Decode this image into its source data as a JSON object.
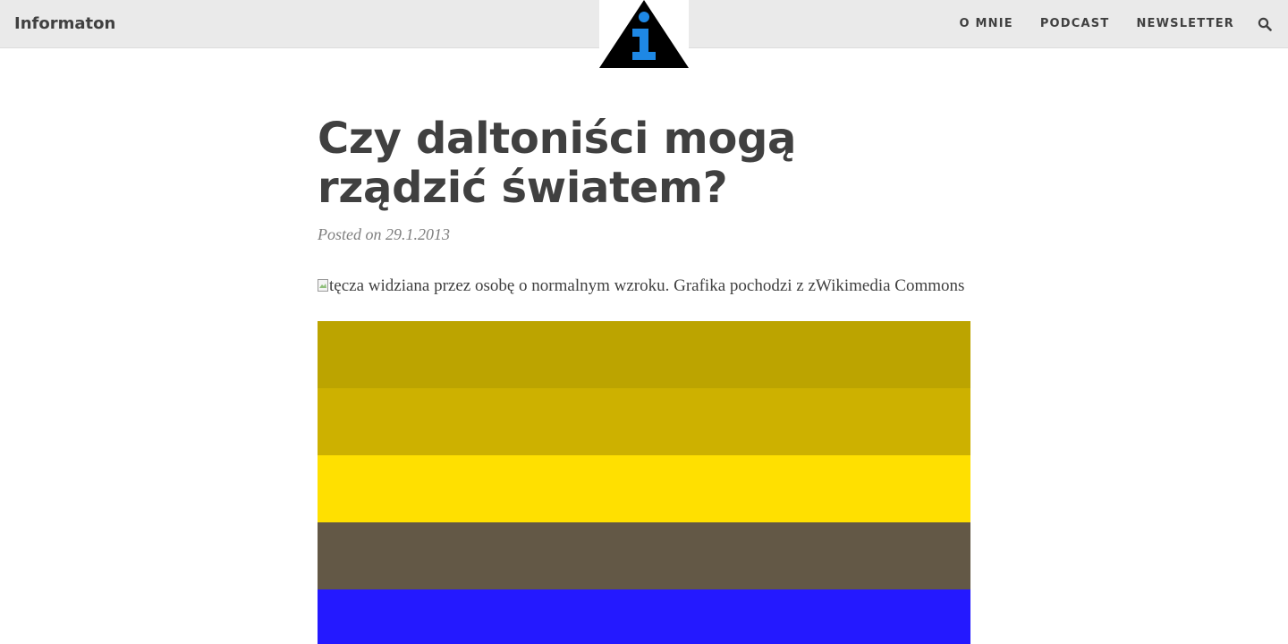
{
  "header": {
    "brand": "Informaton",
    "logo_icon": "info-triangle-icon",
    "logo_colors": {
      "triangle": "#000000",
      "letter": "#1e88e5"
    },
    "nav": [
      {
        "label": "O MNIE"
      },
      {
        "label": "PODCAST"
      },
      {
        "label": "NEWSLETTER"
      }
    ],
    "search_icon": "search-icon"
  },
  "article": {
    "title": "Czy daltoniści mogą rządzić światem?",
    "posted": "Posted on 29.1.2013",
    "image_alt": "tęcza widziana przez osobę o normalnym wzroku. Grafika pochodzi z zWikimedia Commons",
    "stripes": [
      {
        "color": "#bca400"
      },
      {
        "color": "#cdb100"
      },
      {
        "color": "#ffe000"
      },
      {
        "color": "#635846"
      },
      {
        "color": "#2419ff"
      }
    ]
  }
}
